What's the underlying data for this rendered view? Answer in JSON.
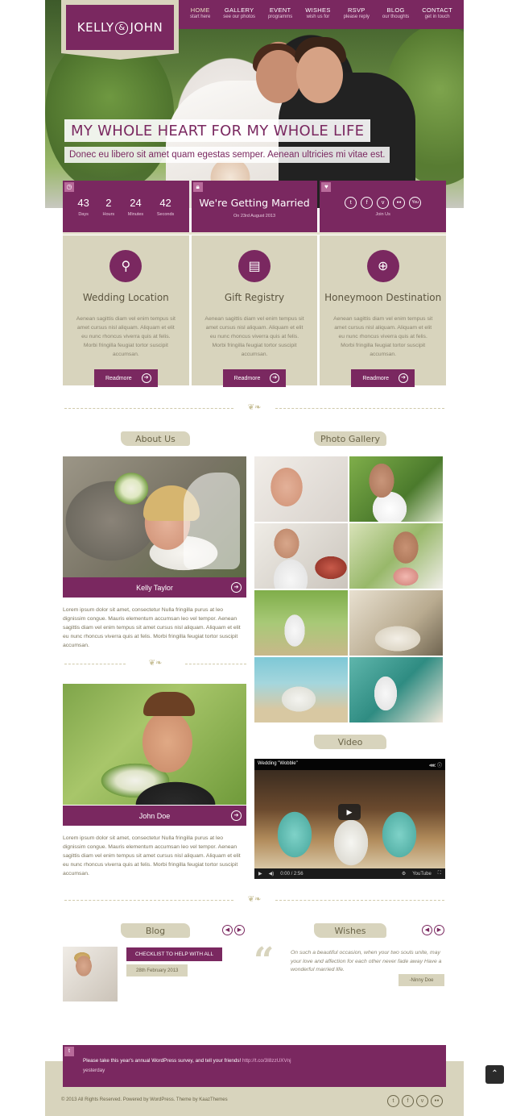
{
  "brand": {
    "name_left": "KELLY",
    "amp": "&",
    "name_right": "JOHN"
  },
  "nav": [
    {
      "title": "HOME",
      "sub": "start here"
    },
    {
      "title": "GALLERY",
      "sub": "see our photos"
    },
    {
      "title": "EVENT",
      "sub": "programms"
    },
    {
      "title": "WISHES",
      "sub": "wish us for"
    },
    {
      "title": "RSVP",
      "sub": "please reply"
    },
    {
      "title": "BLOG",
      "sub": "our thoughts"
    },
    {
      "title": "CONTACT",
      "sub": "get in touch"
    }
  ],
  "hero": {
    "title": "MY WHOLE HEART FOR MY WHOLE LIFE",
    "subtitle": "Donec eu libero sit amet quam egestas semper. Aenean ultricies mi vitae est."
  },
  "countdown": [
    {
      "value": "43",
      "label": "Days"
    },
    {
      "value": "2",
      "label": "Hours"
    },
    {
      "value": "24",
      "label": "Minutes"
    },
    {
      "value": "42",
      "label": "Seconds"
    }
  ],
  "married": {
    "title": "We're Getting Married",
    "date": "On 23rd August 2013"
  },
  "social": {
    "items": [
      "t",
      "f",
      "v",
      "●●",
      "You"
    ],
    "join": "Join Us"
  },
  "features": [
    {
      "icon": "map-pin-icon",
      "glyph": "⚲",
      "title": "Wedding Location",
      "text": "Aenean sagittis diam vel enim tempus sit amet cursus nisl aliquam. Aliquam et elit eu nunc rhoncus viverra quis at felis. Morbi fringilla feugiat tortor suscipit accumsan.",
      "btn": "Readmore"
    },
    {
      "icon": "clipboard-icon",
      "glyph": "▤",
      "title": "Gift Registry",
      "text": "Aenean sagittis diam vel enim tempus sit amet cursus nisl aliquam. Aliquam et elit eu nunc rhoncus viverra quis at felis. Morbi fringilla feugiat tortor suscipit accumsan.",
      "btn": "Readmore"
    },
    {
      "icon": "globe-icon",
      "glyph": "⊕",
      "title": "Honeymoon Destination",
      "text": "Aenean sagittis diam vel enim tempus sit amet cursus nisl aliquam. Aliquam et elit eu nunc rhoncus viverra quis at felis. Morbi fringilla feugiat tortor suscipit accumsan.",
      "btn": "Readmore"
    }
  ],
  "headings": {
    "about": "About Us",
    "gallery": "Photo Gallery",
    "video": "Video",
    "blog": "Blog",
    "wishes": "Wishes"
  },
  "about": [
    {
      "name": "Kelly Taylor",
      "text": "Lorem ipsum dolor sit amet, consectetur Nulla fringilla purus at leo dignissim congue. Mauris elementum accumsan leo vel tempor. Aenean sagittis diam vel enim tempus sit amet cursus nisl aliquam. Aliquam et elit eu nunc rhoncus viverra quis at felis. Morbi fringilla feugiat tortor suscipit accumsan."
    },
    {
      "name": "John Doe",
      "text": "Lorem ipsum dolor sit amet, consectetur Nulla fringilla purus at leo dignissim congue. Mauris elementum accumsan leo vel tempor. Aenean sagittis diam vel enim tempus sit amet cursus nisl aliquam. Aliquam et elit eu nunc rhoncus viverra quis at felis. Morbi fringilla feugiat tortor suscipit accumsan."
    }
  ],
  "video": {
    "title": "Wedding \"Wobble\"",
    "time": "0:00 / 2:56",
    "brand": "YouTube"
  },
  "blog": {
    "title": "CHECKLIST TO HELP WITH ALL",
    "date": "28th February 2013"
  },
  "wish": {
    "text": "On such a beautiful occasion, when your two souls unite, may your love and affection for each other never fade away Have a wonderful married life.",
    "author": "-Ninny Doe"
  },
  "tweet": {
    "text": "Please take this year's annual WordPress survey, and tell your friends!",
    "link": "http://t.co/3I8zzUXVnj",
    "when": "yesterday"
  },
  "footer": {
    "copyright": "© 2013 All Rights Reserved. Powered by WordPress. Theme by KaazThemes"
  },
  "colors": {
    "primary": "#7a2860",
    "beige": "#d8d4bd"
  }
}
